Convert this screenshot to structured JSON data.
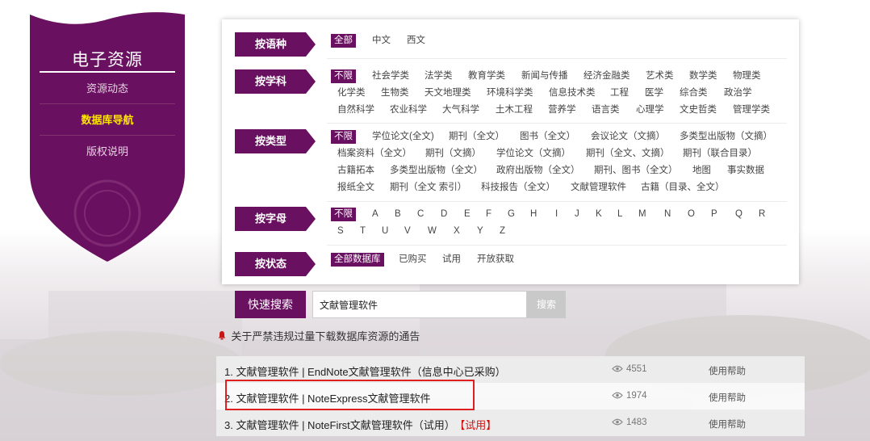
{
  "sidebar": {
    "title": "电子资源",
    "items": [
      {
        "label": "资源动态",
        "active": false
      },
      {
        "label": "数据库导航",
        "active": true
      },
      {
        "label": "版权说明",
        "active": false
      }
    ]
  },
  "filters": {
    "language": {
      "label": "按语种",
      "options": [
        "全部",
        "中文",
        "西文"
      ],
      "selected": "全部"
    },
    "subject": {
      "label": "按学科",
      "options": [
        "不限",
        "社会学类",
        "法学类",
        "教育学类",
        "新闻与传播",
        "经济金融类",
        "艺术类",
        "数学类",
        "物理类",
        "化学类",
        "生物类",
        "天文地理类",
        "环境科学类",
        "信息技术类",
        "工程",
        "医学",
        "综合类",
        "政治学",
        "自然科学",
        "农业科学",
        "大气科学",
        "土木工程",
        "营养学",
        "语言类",
        "心理学",
        "文史哲类",
        "管理学类"
      ],
      "selected": "不限"
    },
    "type": {
      "label": "按类型",
      "options": [
        "不限",
        "学位论文(全文)",
        "期刊（全文）",
        "图书（全文）",
        "会议论文（文摘）",
        "多类型出版物（文摘）",
        "档案资料（全文）",
        "期刊（文摘）",
        "学位论文（文摘）",
        "期刊（全文、文摘）",
        "期刊（联合目录）",
        "古籍拓本",
        "多类型出版物（全文）",
        "政府出版物（全文）",
        "期刊、图书（全文）",
        "地图",
        "事实数据",
        "报纸全文",
        "期刊（全文 索引）",
        "科技报告（全文）",
        "文献管理软件",
        "古籍（目录、全文）"
      ],
      "selected": "不限"
    },
    "letter": {
      "label": "按字母",
      "options": [
        "不限",
        "A",
        "B",
        "C",
        "D",
        "E",
        "F",
        "G",
        "H",
        "I",
        "J",
        "K",
        "L",
        "M",
        "N",
        "O",
        "P",
        "Q",
        "R",
        "S",
        "T",
        "U",
        "V",
        "W",
        "X",
        "Y",
        "Z"
      ],
      "selected": "不限"
    },
    "status": {
      "label": "按状态",
      "options": [
        "全部数据库",
        "已购买",
        "试用",
        "开放获取"
      ],
      "selected": "全部数据库"
    }
  },
  "search": {
    "label": "快速搜索",
    "value": "文献管理软件",
    "button": "搜索"
  },
  "notice": "关于严禁违规过量下载数据库资源的通告",
  "results": [
    {
      "title": "1. 文献管理软件 | EndNote文献管理软件（信息中心已采购）",
      "trial": "",
      "views": "4551",
      "help": "使用帮助"
    },
    {
      "title": "2. 文献管理软件 | NoteExpress文献管理软件",
      "trial": "",
      "views": "1974",
      "help": "使用帮助"
    },
    {
      "title": "3. 文献管理软件 | NoteFirst文献管理软件（试用）",
      "trial": "【试用】",
      "views": "1483",
      "help": "使用帮助"
    }
  ],
  "colors": {
    "brand": "#6a1060",
    "active_menu": "#ffe600",
    "highlight_box": "#e02020",
    "trial": "#d01010"
  }
}
